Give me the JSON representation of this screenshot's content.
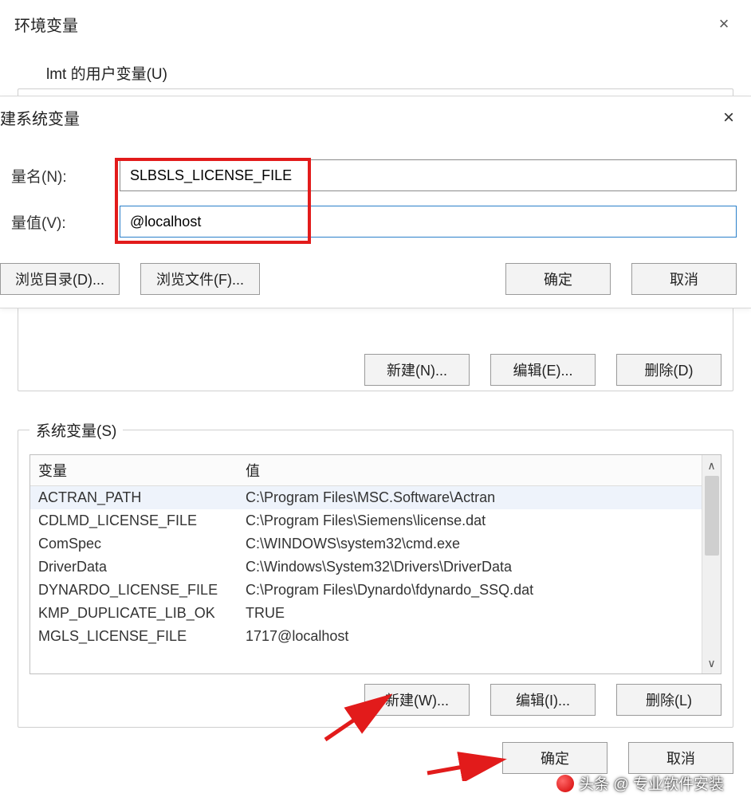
{
  "env_dialog": {
    "title": "环境变量",
    "close": "×",
    "user_section_label": "lmt 的用户变量(U)",
    "user_buttons": {
      "new": "新建(N)...",
      "edit": "编辑(E)...",
      "delete": "删除(D)"
    },
    "sys_section_label": "系统变量(S)",
    "table": {
      "col_var": "变量",
      "col_val": "值",
      "rows": [
        {
          "var": "ACTRAN_PATH",
          "val": "C:\\Program Files\\MSC.Software\\Actran"
        },
        {
          "var": "CDLMD_LICENSE_FILE",
          "val": "C:\\Program Files\\Siemens\\license.dat"
        },
        {
          "var": "ComSpec",
          "val": "C:\\WINDOWS\\system32\\cmd.exe"
        },
        {
          "var": "DriverData",
          "val": "C:\\Windows\\System32\\Drivers\\DriverData"
        },
        {
          "var": "DYNARDO_LICENSE_FILE",
          "val": "C:\\Program Files\\Dynardo\\fdynardo_SSQ.dat"
        },
        {
          "var": "KMP_DUPLICATE_LIB_OK",
          "val": "TRUE"
        },
        {
          "var": "MGLS_LICENSE_FILE",
          "val": "1717@localhost"
        }
      ]
    },
    "sys_buttons": {
      "new": "新建(W)...",
      "edit": "编辑(I)...",
      "delete": "删除(L)"
    },
    "bottom": {
      "ok": "确定",
      "cancel": "取消"
    }
  },
  "new_var_dialog": {
    "title": "建系统变量",
    "close": "×",
    "name_label": "量名(N):",
    "name_value": "SLBSLS_LICENSE_FILE",
    "value_label": "量值(V):",
    "value_value": "@localhost",
    "browse_dir": "浏览目录(D)...",
    "browse_file": "浏览文件(F)...",
    "ok": "确定",
    "cancel": "取消"
  },
  "watermark": "头条 @ 专业软件安装"
}
